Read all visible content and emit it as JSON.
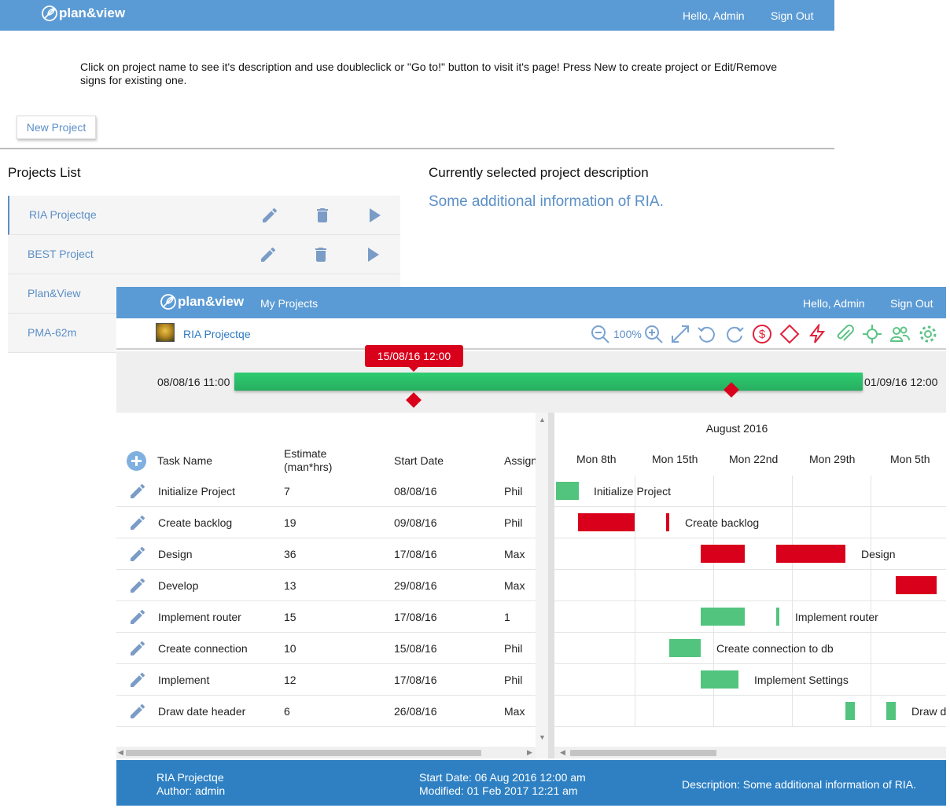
{
  "back_window": {
    "brand": "plan&view",
    "nav": {
      "greeting": "Hello, Admin",
      "sign_out": "Sign Out"
    },
    "instructions": "Click on project name to see it's description and use doubleclick or \"Go to!\" button to visit it's page! Press New to create project or Edit/Remove signs for existing one.",
    "new_project_label": "New Project",
    "projects_list_title": "Projects List",
    "projects": [
      {
        "name": "RIA Projectqe"
      },
      {
        "name": "BEST Project"
      },
      {
        "name": "Plan&View"
      },
      {
        "name": "PMA-62m"
      }
    ],
    "description_title": "Currently selected project description",
    "description_text": "Some additional information of RIA."
  },
  "app": {
    "brand": "plan&view",
    "nav": {
      "my_projects": "My Projects",
      "greeting": "Hello, Admin",
      "sign_out": "Sign Out"
    },
    "project_title": "RIA Projectqe",
    "zoom": "100%",
    "icons": [
      "zoom-out-icon",
      "zoom-in-icon",
      "fullscreen-icon",
      "undo-icon",
      "redo-icon",
      "dollar-icon",
      "diamond-icon",
      "lightning-icon",
      "attachment-icon",
      "critical-path-icon",
      "users-icon",
      "settings-icon"
    ],
    "timeline": {
      "start": "08/08/16 11:00",
      "end": "01/09/16 12:00",
      "current": "15/08/16 12:00"
    },
    "grid": {
      "columns": {
        "name": "Task Name",
        "estimate": "Estimate (man*hrs)",
        "start": "Start Date",
        "assign": "Assign"
      },
      "rows": [
        {
          "name": "Initialize Project",
          "estimate": "7",
          "start": "08/08/16",
          "assign": "Phil"
        },
        {
          "name": "Create backlog",
          "estimate": "19",
          "start": "09/08/16",
          "assign": "Phil"
        },
        {
          "name": "Design",
          "estimate": "36",
          "start": "17/08/16",
          "assign": "Max"
        },
        {
          "name": "Develop",
          "estimate": "13",
          "start": "29/08/16",
          "assign": "Max"
        },
        {
          "name": "Implement router",
          "estimate": "15",
          "start": "17/08/16",
          "assign": "1"
        },
        {
          "name": "Create connection",
          "estimate": "10",
          "start": "15/08/16",
          "assign": "Phil"
        },
        {
          "name": "Implement",
          "estimate": "12",
          "start": "17/08/16",
          "assign": "Phil"
        },
        {
          "name": "Draw date header",
          "estimate": "6",
          "start": "26/08/16",
          "assign": "Max"
        }
      ]
    },
    "gantt": {
      "month": "August 2016",
      "weeks": [
        "Mon 8th",
        "Mon 15th",
        "Mon 22nd",
        "Mon 29th",
        "Mon 5th"
      ],
      "labels": [
        "Initialize Project",
        "Create backlog",
        "Design",
        "",
        "Implement router",
        "Create connection to db",
        "Implement Settings",
        "Draw d"
      ]
    },
    "footer": {
      "project": "RIA Projectqe",
      "author": "Author: admin",
      "start_date": "Start Date: 06 Aug 2016 12:00 am",
      "modified": "Modified: 01 Feb 2017 12:21 am",
      "description": "Description: Some additional information of RIA."
    },
    "colors": {
      "brand_blue": "#5b9bd5",
      "footer_blue": "#2e80c3",
      "task_green": "#52c47d",
      "critical_red": "#d9001b"
    }
  }
}
